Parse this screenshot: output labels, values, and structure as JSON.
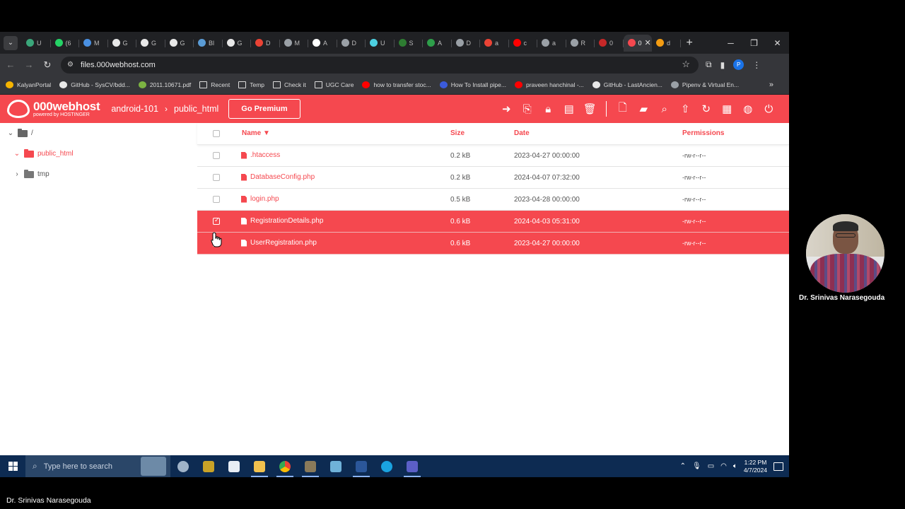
{
  "browser": {
    "tabs": [
      {
        "label": "U",
        "color": "#3aa67a"
      },
      {
        "label": "(6",
        "color": "#25d366"
      },
      {
        "label": "M",
        "color": "#4a90e2"
      },
      {
        "label": "G",
        "color": "#e8e8e8"
      },
      {
        "label": "G",
        "color": "#e8e8e8"
      },
      {
        "label": "G",
        "color": "#e8e8e8"
      },
      {
        "label": "Bl",
        "color": "#5a9bd5"
      },
      {
        "label": "G",
        "color": "#e8e8e8"
      },
      {
        "label": "D",
        "color": "#ea4335"
      },
      {
        "label": "M",
        "color": "#9aa0a6"
      },
      {
        "label": "A",
        "color": "#ffffff"
      },
      {
        "label": "D",
        "color": "#9aa0a6"
      },
      {
        "label": "U",
        "color": "#4dd0e1"
      },
      {
        "label": "S",
        "color": "#2e7d32"
      },
      {
        "label": "A",
        "color": "#2e9e4a"
      },
      {
        "label": "D",
        "color": "#9aa0a6"
      },
      {
        "label": "a",
        "color": "#ea4335"
      },
      {
        "label": "c",
        "color": "#ff0000"
      },
      {
        "label": "a",
        "color": "#9aa0a6"
      },
      {
        "label": "R",
        "color": "#9aa0a6"
      },
      {
        "label": "0",
        "color": "#c62828"
      },
      {
        "label": "0",
        "color": "#f5484f",
        "active": true
      },
      {
        "label": "d",
        "color": "#f39c12"
      }
    ],
    "url": "files.000webhost.com",
    "profile_initial": "P",
    "bookmarks": [
      {
        "label": "KalyanPortal",
        "color": "#f5b400"
      },
      {
        "label": "GitHub - SysCV/bdd...",
        "color": "#e8e8e8"
      },
      {
        "label": "2011.10671.pdf",
        "color": "#7cb342"
      },
      {
        "label": "Recent",
        "color": "#dcdcdc"
      },
      {
        "label": "Temp",
        "color": "#dcdcdc"
      },
      {
        "label": "Check it",
        "color": "#dcdcdc"
      },
      {
        "label": "UGC Care",
        "color": "#dcdcdc"
      },
      {
        "label": "how to transfer stoc...",
        "color": "#ff0000"
      },
      {
        "label": "How To Install pipe...",
        "color": "#3b5bdb"
      },
      {
        "label": "praveen hanchinal -...",
        "color": "#ff0000"
      },
      {
        "label": "GitHub - LastAncien...",
        "color": "#e8e8e8"
      },
      {
        "label": "Pipenv & Virtual En...",
        "color": "#9aa0a6"
      }
    ]
  },
  "app": {
    "logo_main": "000webhost",
    "logo_sub": "powered by HOSTINGER",
    "breadcrumb": [
      "android-101",
      "public_html"
    ],
    "premium_label": "Go Premium",
    "accent": "#f5484f"
  },
  "tree": {
    "root": "/",
    "items": [
      {
        "label": "public_html",
        "expanded": true
      },
      {
        "label": "tmp",
        "expanded": false
      }
    ]
  },
  "table": {
    "headers": {
      "name": "Name ▼",
      "size": "Size",
      "date": "Date",
      "permissions": "Permissions"
    },
    "rows": [
      {
        "name": ".htaccess",
        "size": "0.2 kB",
        "date": "2023-04-27 00:00:00",
        "perm": "-rw-r--r--",
        "selected": false
      },
      {
        "name": "DatabaseConfig.php",
        "size": "0.2 kB",
        "date": "2024-04-07 07:32:00",
        "perm": "-rw-r--r--",
        "selected": false
      },
      {
        "name": "login.php",
        "size": "0.5 kB",
        "date": "2023-04-28 00:00:00",
        "perm": "-rw-r--r--",
        "selected": false
      },
      {
        "name": "RegistrationDetails.php",
        "size": "0.6 kB",
        "date": "2024-04-03 05:31:00",
        "perm": "-rw-r--r--",
        "selected": true
      },
      {
        "name": "UserRegistration.php",
        "size": "0.6 kB",
        "date": "2023-04-27 00:00:00",
        "perm": "-rw-r--r--",
        "selected": true
      }
    ]
  },
  "taskbar": {
    "search_placeholder": "Type here to search",
    "time": "1:22 PM",
    "date": "4/7/2024"
  },
  "presenter": {
    "name": "Dr. Srinivas Narasegouda",
    "caption": "Dr. Srinivas Narasegouda"
  }
}
